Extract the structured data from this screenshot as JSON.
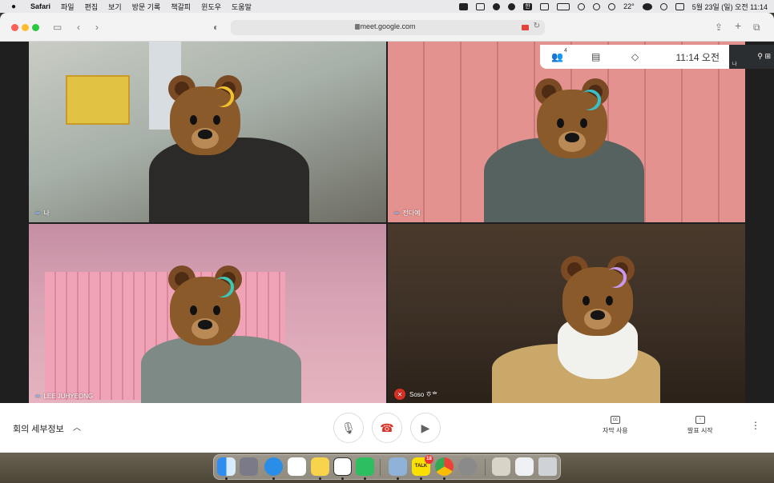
{
  "menubar": {
    "app": "Safari",
    "items": [
      "파일",
      "편집",
      "보기",
      "방문 기록",
      "책갈피",
      "윈도우",
      "도움말"
    ],
    "weather": "22°",
    "datetime": "5월 23일 (일) 오전 11:14",
    "input_indicator": "한"
  },
  "browser": {
    "url": "meet.google.com"
  },
  "meet": {
    "participant_count": "4",
    "clock": "11:14 오전",
    "tiles": [
      {
        "name": "나",
        "muted": false,
        "curl_color": "#f2c12e"
      },
      {
        "name": "전다예",
        "muted": false,
        "curl_color": "#37c0c7"
      },
      {
        "name": "LEE JUHYEONG",
        "muted": false,
        "curl_color": "#3cc7b7"
      },
      {
        "name": "Soso ᄒᆞᄒ",
        "muted": true,
        "curl_color": "#c79af0"
      }
    ],
    "self_label": "나"
  },
  "controls": {
    "meeting_details": "회의 세부정보",
    "captions": "자막 사용",
    "present": "발표 시작"
  },
  "dock": {
    "kakaotalk_badge": "18",
    "kakaotalk_label": "TALK"
  },
  "colors": {
    "accent_blue": "#8ab4f8",
    "end_call_red": "#d93025"
  }
}
